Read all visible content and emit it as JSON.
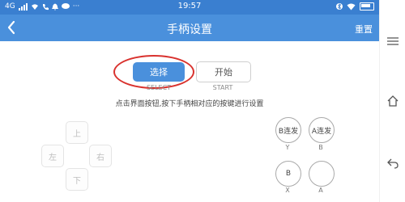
{
  "status_bar": {
    "network": "4G",
    "time": "19:57"
  },
  "header": {
    "title": "手柄设置",
    "reset_label": "重置"
  },
  "controls": {
    "select_label": "选择",
    "select_caption": "SELECT",
    "start_label": "开始",
    "start_caption": "START",
    "instruction": "点击界面按钮,按下手柄相对应的按键进行设置"
  },
  "dpad": {
    "up": "上",
    "left": "左",
    "right": "右",
    "down": "下"
  },
  "buttons": {
    "b_turbo": "B连发",
    "b_turbo_caption": "Y",
    "a_turbo": "A连发",
    "a_turbo_caption": "B",
    "b": "B",
    "b_caption": "X",
    "a": "",
    "a_caption": "A"
  },
  "colors": {
    "accent": "#4a90dc",
    "status_bar": "#3a7fd0",
    "highlight": "#d9322e"
  }
}
